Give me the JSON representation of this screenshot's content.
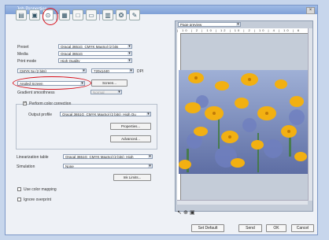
{
  "window": {
    "title": "Job Properties",
    "close": "×"
  },
  "toolbar": {
    "buttons": [
      "▤",
      "▣",
      "⊙",
      "▦",
      "□",
      "▭",
      "▥",
      "❂",
      "✎"
    ]
  },
  "form": {
    "preset_label": "Preset",
    "preset_value": "Oracal 3651G_CMYK MaxSol (2 bits",
    "media_label": "Media",
    "media_value": "Oracal 3651G",
    "printmode_label": "Print mode",
    "printmode_value": "High Quality",
    "colormode_value": "CMYK 5x (2 bits)",
    "resolution_value": "720x1440",
    "dpi_label": "DPI",
    "screening_value": "Angled Screen",
    "screen_button": "Screen...",
    "gradient_label": "Gradient smoothness",
    "gradient_value": "Normal",
    "perform_color_label": "Perform color correction",
    "output_profile_label": "Output profile",
    "output_profile_value": "Oracal 3651G_CMYK MaxSol (2 bits)_High Qu",
    "properties_button": "Properties...",
    "advanced_button": "Advanced...",
    "linearization_label": "Linearization table",
    "linearization_value": "Oracal 3651G_CMYK MaxSol (2 bits)_High",
    "simulation_label": "Simulation",
    "simulation_value": "None",
    "inklimits_button": "Ink Limits...",
    "use_color_mapping_label": "Use color mapping",
    "ignore_overprint_label": "Ignore overprint"
  },
  "preview": {
    "mode_value": "Page preview",
    "ruler_text": "| 10 | 2 | 10 | 12 | 10 | 2 | 10 | 4 | 10 | 6"
  },
  "footer": {
    "set_default": "Set Default",
    "send": "Send",
    "ok": "OK",
    "cancel": "Cancel"
  }
}
